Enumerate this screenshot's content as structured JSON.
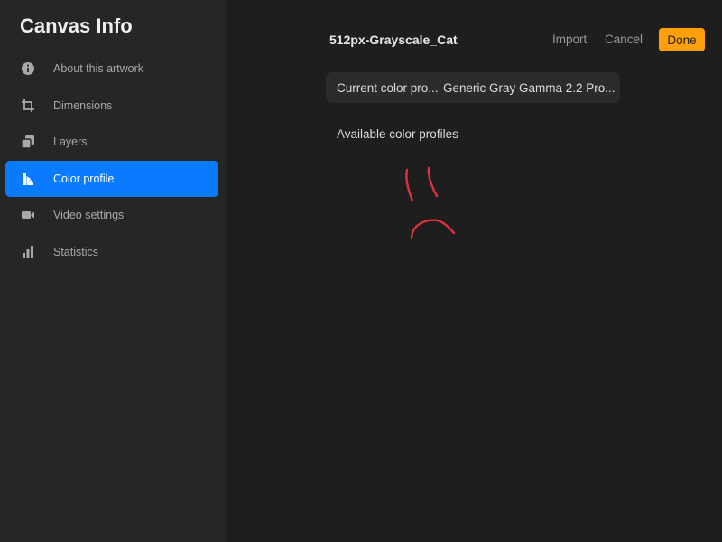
{
  "sidebar": {
    "title": "Canvas Info",
    "items": [
      {
        "label": "About this artwork",
        "icon": "info-icon",
        "active": false
      },
      {
        "label": "Dimensions",
        "icon": "crop-icon",
        "active": false
      },
      {
        "label": "Layers",
        "icon": "layers-icon",
        "active": false
      },
      {
        "label": "Color profile",
        "icon": "color-profile-icon",
        "active": true
      },
      {
        "label": "Video settings",
        "icon": "video-camera-icon",
        "active": false
      },
      {
        "label": "Statistics",
        "icon": "bar-chart-icon",
        "active": false
      }
    ]
  },
  "header": {
    "title": "512px-Grayscale_Cat",
    "import_label": "Import",
    "cancel_label": "Cancel",
    "done_label": "Done"
  },
  "content": {
    "current_profile_label": "Current color pro...",
    "current_profile_value": "Generic Gray Gamma 2.2 Pro...",
    "available_label": "Available color profiles"
  },
  "colors": {
    "accent_blue": "#0a7bff",
    "done_orange": "#ff9f0a",
    "annotation_red": "#e0303c"
  }
}
